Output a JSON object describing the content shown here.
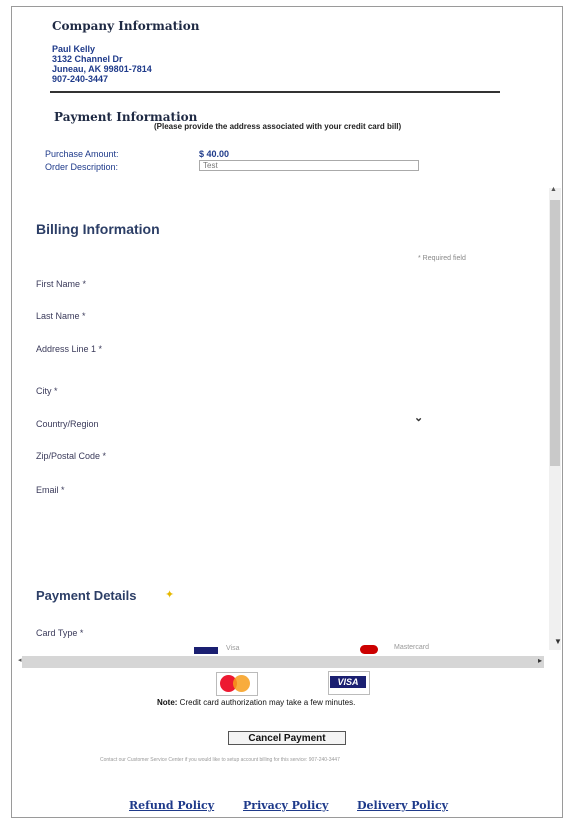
{
  "company": {
    "title": "Company Information",
    "name": "Paul Kelly",
    "address1": "3132 Channel Dr",
    "address2": "Juneau, AK  99801-7814",
    "phone": "907-240-3447"
  },
  "payment_info": {
    "title": "Payment Information",
    "subtitle": "(Please provide the address associated with your credit card bill)",
    "purchase_label": "Purchase Amount:",
    "purchase_value": "$ 40.00",
    "order_label": "Order Description:",
    "order_value": "Test"
  },
  "billing": {
    "title": "Billing Information",
    "required_note": "* Required field",
    "fields": [
      "First Name *",
      "Last Name *",
      "Address Line 1 *",
      "City *",
      "Country/Region",
      "Zip/Postal Code *",
      "Email *"
    ],
    "country_chevron": "⌄"
  },
  "payment_details": {
    "title": "Payment Details",
    "card_type_label": "Card Type *",
    "visa_option": "Visa",
    "mastercard_option": "Mastercard"
  },
  "cards": {
    "visa": "VISA"
  },
  "note": {
    "bold": "Note:",
    "text": " Credit card authorization may take a few minutes."
  },
  "cancel_button": "Cancel Payment",
  "fine_print": "Contact our Customer Service Center if you would like to setup account billing for this service: 907-240-3447",
  "policies": [
    "Refund Policy",
    "Privacy Policy",
    "Delivery Policy"
  ],
  "colors": {
    "link": "#1e3a8a",
    "heading": "#2c3e66",
    "visa": "#1a1f71",
    "mastercard_red": "#eb001b",
    "mastercard_yellow": "#f79e1b"
  }
}
